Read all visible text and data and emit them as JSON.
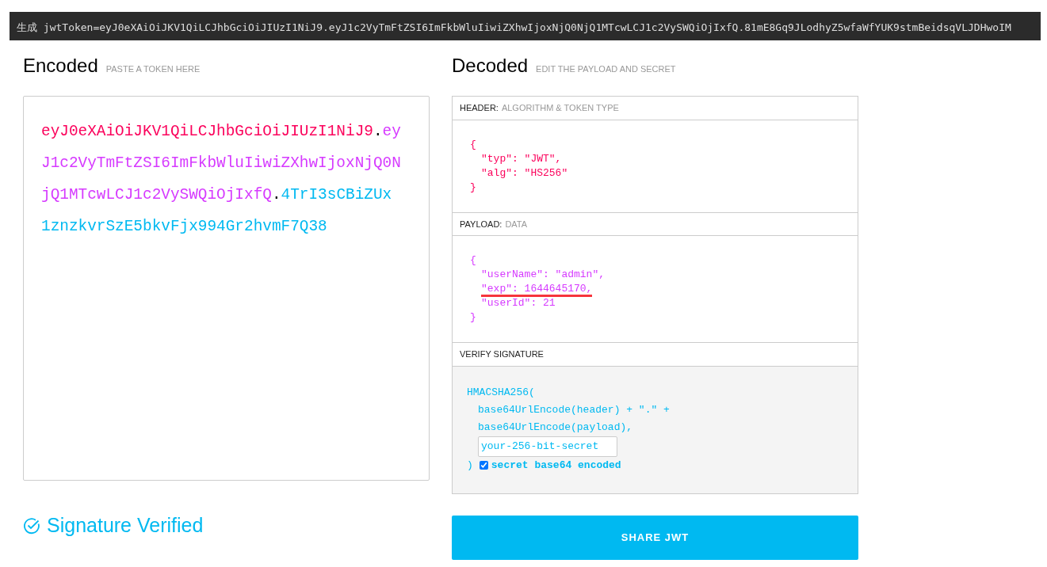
{
  "console": {
    "prefix": "生成",
    "text": "jwtToken=eyJ0eXAiOiJKV1QiLCJhbGciOiJIUzI1NiJ9.eyJ1c2VyTmFtZSI6ImFkbWluIiwiZXhwIjoxNjQ0NjQ1MTcwLCJ1c2VySWQiOjIxfQ.81mE8Gq9JLodhyZ5wfaWfYUK9stmBeidsqVLJDHwoIM"
  },
  "encoded": {
    "title": "Encoded",
    "hint": "PASTE A TOKEN HERE",
    "segments": [
      {
        "text": "eyJ0eXAiOiJKV1QiLCJhbGciOiJIUzI1NiJ9",
        "color": "#fb015b"
      },
      {
        "text": ".",
        "color": "#000000"
      },
      {
        "text": "eyJ1c2VyTmFtZSI6ImFkbWluIiwiZXhwIjoxNjQ0NjQ1MTcwLCJ1c2VySWQiOjIxfQ",
        "color": "#d63aff"
      },
      {
        "text": ".",
        "color": "#000000"
      },
      {
        "text": "4TrI3sCBiZUx1znzkvrSzE5bkvFjx994Gr2hvmF7Q38",
        "color": "#00b9f1"
      }
    ]
  },
  "decoded": {
    "title": "Decoded",
    "hint": "EDIT THE PAYLOAD AND SECRET",
    "sections": [
      {
        "kind": "json",
        "label": "HEADER:",
        "sublabel": "ALGORITHM & TOKEN TYPE",
        "color": "#fb015b",
        "lines": [
          {
            "kind": "brace",
            "text": "{"
          },
          {
            "kind": "entry",
            "text": "\"typ\": \"JWT\","
          },
          {
            "kind": "entry",
            "text": "\"alg\": \"HS256\""
          },
          {
            "kind": "brace",
            "text": "}"
          }
        ]
      },
      {
        "kind": "json",
        "label": "PAYLOAD:",
        "sublabel": "DATA",
        "color": "#d63aff",
        "lines": [
          {
            "kind": "brace",
            "text": "{"
          },
          {
            "kind": "entry",
            "text": "\"userName\": \"admin\","
          },
          {
            "kind": "entry",
            "text": "\"exp\": 1644645170,",
            "underlined": true
          },
          {
            "kind": "entry",
            "text": "\"userId\": 21"
          },
          {
            "kind": "brace",
            "text": "}"
          }
        ]
      },
      {
        "kind": "signature",
        "label": "VERIFY SIGNATURE",
        "color": "#00b9f1",
        "lines": [
          {
            "kind": "brace",
            "text": "HMACSHA256("
          },
          {
            "kind": "entry",
            "text": "base64UrlEncode(header) + \".\" +"
          },
          {
            "kind": "entry",
            "text": "base64UrlEncode(payload),"
          }
        ],
        "secret": {
          "placeholder": "your-256-bit-secret"
        },
        "close": ")",
        "base64": {
          "label": "secret base64 encoded",
          "checked": true
        }
      }
    ]
  },
  "status": {
    "text": "Signature Verified",
    "verified": true
  },
  "share_button": "SHARE JWT"
}
